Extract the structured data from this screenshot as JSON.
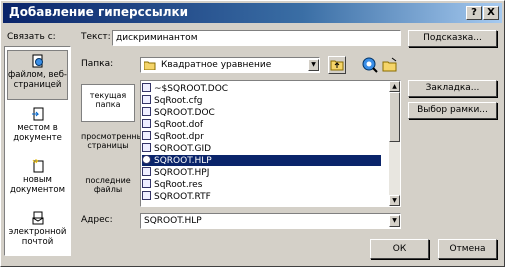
{
  "window": {
    "title": "Добавление гиперссылки",
    "help_label": "?",
    "close_label": "X"
  },
  "link_to": {
    "label": "Связать с:",
    "items": [
      {
        "label": "файлом, веб-страницей",
        "icon": "web-page-icon",
        "selected": true
      },
      {
        "label": "местом в документе",
        "icon": "place-in-document-icon"
      },
      {
        "label": "новым документом",
        "icon": "new-document-icon"
      },
      {
        "label": "электронной почтой",
        "icon": "email-icon"
      }
    ]
  },
  "text": {
    "label": "Текст:",
    "value": "дискриминантом"
  },
  "screentip_button": "Подсказка...",
  "folder": {
    "label": "Папка:",
    "value": "Квадратное уравнение"
  },
  "look_in": [
    {
      "label": "текущая папка"
    },
    {
      "label": "просмотренные страницы"
    },
    {
      "label": "последние файлы"
    }
  ],
  "files": [
    {
      "name": "~$SQROOT.DOC",
      "icon": "word-doc-icon"
    },
    {
      "name": "SqRoot.cfg",
      "icon": "file-icon"
    },
    {
      "name": "SQROOT.DOC",
      "icon": "word-doc-icon"
    },
    {
      "name": "SqRoot.dof",
      "icon": "file-icon"
    },
    {
      "name": "SqRoot.dpr",
      "icon": "delphi-project-icon"
    },
    {
      "name": "SQROOT.GID",
      "icon": "file-icon"
    },
    {
      "name": "SQROOT.HLP",
      "icon": "help-file-icon",
      "selected": true
    },
    {
      "name": "SQROOT.HPJ",
      "icon": "file-icon"
    },
    {
      "name": "SqRoot.res",
      "icon": "file-icon"
    },
    {
      "name": "SQROOT.RTF",
      "icon": "word-doc-icon"
    }
  ],
  "bookmark_button": "Закладка...",
  "target_frame_button": "Выбор рамки...",
  "address": {
    "label": "Адрес:",
    "value": "SQROOT.HLP"
  },
  "ok_button": "ОК",
  "cancel_button": "Отмена",
  "colors": {
    "titlebar": "#0a246a",
    "selection": "#0a246a",
    "face": "#d4d0c8"
  }
}
